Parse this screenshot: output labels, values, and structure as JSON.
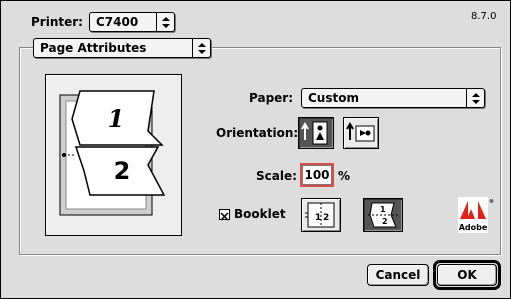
{
  "version": "8.7.0",
  "printer": {
    "label": "Printer:",
    "value": "C7400"
  },
  "panel": {
    "value": "Page Attributes"
  },
  "paper": {
    "label": "Paper:",
    "value": "Custom"
  },
  "orientation": {
    "label": "Orientation:",
    "selected": "portrait"
  },
  "scale": {
    "label": "Scale:",
    "value": "100",
    "unit": "%"
  },
  "booklet": {
    "label": "Booklet",
    "checked": true,
    "check_mark": "✕"
  },
  "preview": {
    "page1": "1",
    "page2": "2"
  },
  "logo": {
    "name": "Adobe",
    "text": "Adobe"
  },
  "buttons": {
    "cancel": "Cancel",
    "ok": "OK"
  },
  "popup_arrows": "◆"
}
